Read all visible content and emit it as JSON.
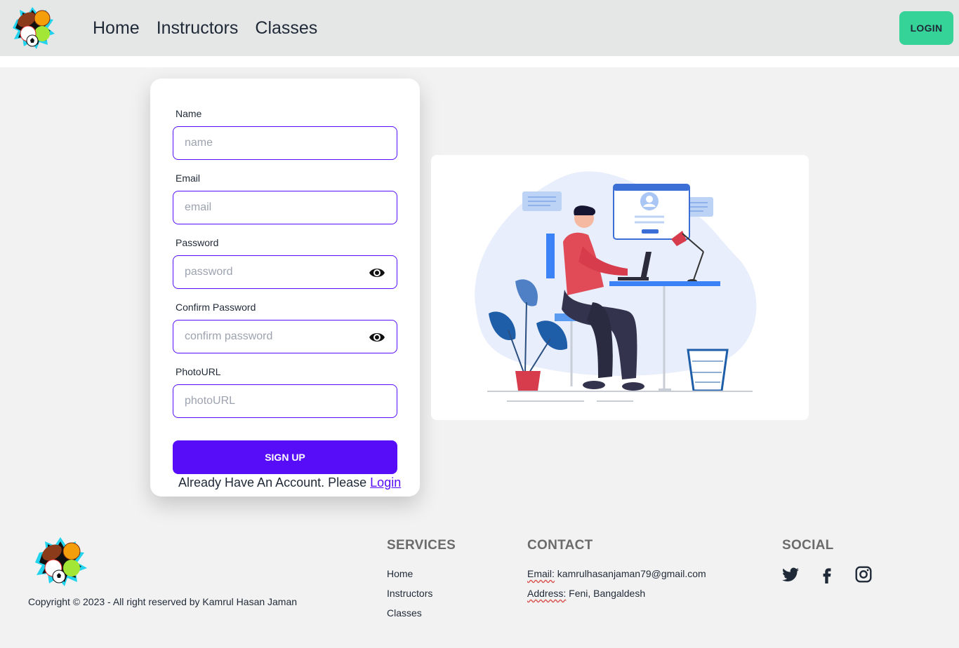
{
  "nav": {
    "links": [
      "Home",
      "Instructors",
      "Classes"
    ],
    "login_label": "LOGIN"
  },
  "form": {
    "fields": [
      {
        "label": "Name",
        "placeholder": "name",
        "value": ""
      },
      {
        "label": "Email",
        "placeholder": "email",
        "value": ""
      },
      {
        "label": "Password",
        "placeholder": "password",
        "value": "",
        "icon": "eye-icon"
      },
      {
        "label": "Confirm Password",
        "placeholder": "confirm password",
        "value": "",
        "icon": "eye-icon"
      },
      {
        "label": "PhotoURL",
        "placeholder": "photoURL",
        "value": ""
      }
    ],
    "submit_label": "SIGN UP",
    "account_prompt": "Already Have An Account. Please ",
    "account_link": "Login"
  },
  "footer": {
    "copyright": "Copyright © 2023 - All right reserved by Kamrul Hasan Jaman",
    "services": {
      "title": "SERVICES",
      "items": [
        "Home",
        "Instructors",
        "Classes"
      ]
    },
    "contact": {
      "title": "CONTACT",
      "email_label": "Email:",
      "email_value": "kamrulhasanjaman79@gmail.com",
      "address_label": "Address:",
      "address_value": "Feni, Bangaldesh"
    },
    "social": {
      "title": "SOCIAL",
      "icons": [
        "twitter-icon",
        "facebook-icon",
        "instagram-icon"
      ]
    }
  },
  "colors": {
    "primary": "#570df8",
    "accent": "#36d399",
    "navbar_bg": "#e5e6e6",
    "page_bg": "#f2f2f2"
  }
}
